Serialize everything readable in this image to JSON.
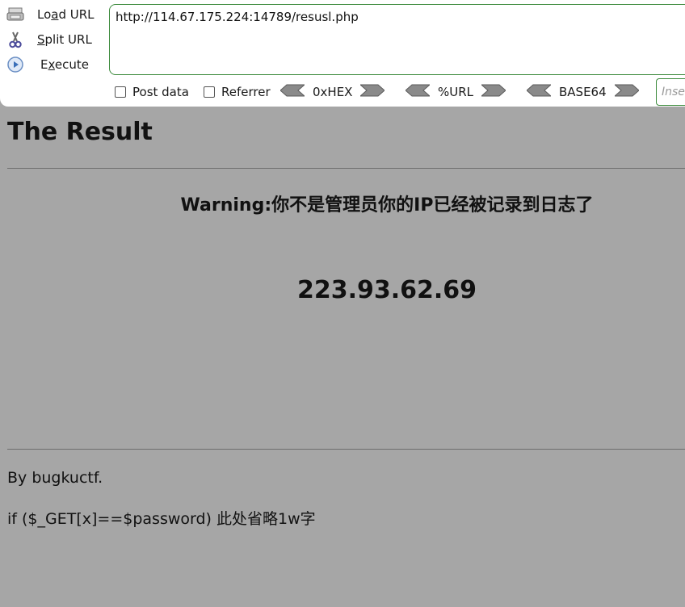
{
  "hackbar": {
    "buttons": [
      {
        "prefix": "Lo",
        "accel": "a",
        "suffix": "d URL",
        "icon": "load-url-icon"
      },
      {
        "prefix": "",
        "accel": "S",
        "suffix": "plit URL",
        "icon": "scissors-icon"
      },
      {
        "prefix": "E",
        "accel": "x",
        "suffix": "ecute",
        "icon": "play-icon"
      }
    ],
    "url": "http://114.67.175.224:14789/resusl.php",
    "post_data_label": "Post data",
    "referrer_label": "Referrer",
    "encoders": [
      "0xHEX",
      "%URL",
      "BASE64"
    ],
    "insert_placeholder": "Inse"
  },
  "page": {
    "title": "The Result",
    "warning": "Warning:你不是管理员你的IP已经被记录到日志了",
    "ip": "223.93.62.69",
    "footer_by": "By bugkuctf.",
    "footer_code": "if ($_GET[x]==$password) 此处省略1w字"
  },
  "colors": {
    "page_bg": "#a6a6a6",
    "url_border": "#3c8a3c"
  }
}
